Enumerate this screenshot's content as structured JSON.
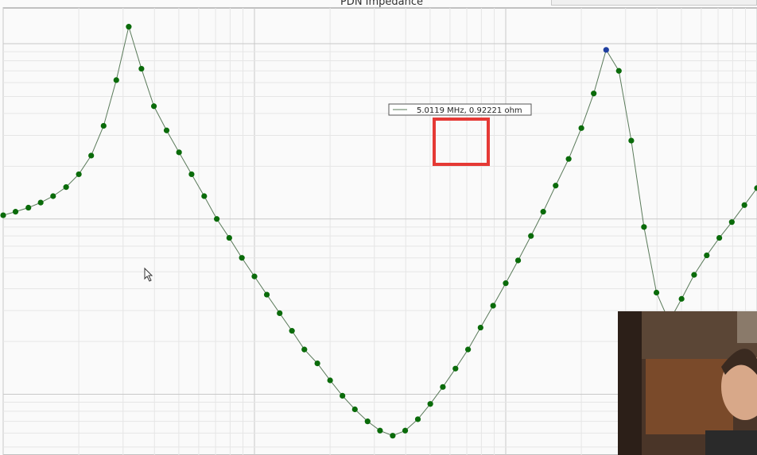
{
  "chart_data": {
    "type": "line",
    "title": "PDN Impedance",
    "xscale": "log",
    "yscale": "log",
    "grid": true,
    "series": [
      {
        "x": [
          0.1,
          0.112,
          0.126,
          0.141,
          0.158,
          0.178,
          0.2,
          0.224,
          0.251,
          0.282,
          0.316,
          0.355,
          0.398,
          0.447,
          0.501,
          0.562,
          0.631,
          0.708,
          0.794,
          0.891,
          1.0,
          1.12,
          1.26,
          1.41,
          1.58,
          1.78,
          2.0,
          2.24,
          2.51,
          2.82,
          3.16,
          3.55,
          3.98,
          4.47,
          5.01,
          5.62,
          6.31,
          7.08,
          7.94,
          8.91,
          10.0,
          11.2,
          12.6,
          14.1,
          15.8,
          17.8,
          20.0,
          22.4,
          25.1,
          28.2,
          31.6,
          35.5,
          39.8,
          44.7,
          50.1,
          56.2,
          63.1,
          70.8,
          79.4,
          89.1,
          100
        ],
        "y": [
          0.105,
          0.11,
          0.116,
          0.124,
          0.135,
          0.152,
          0.18,
          0.23,
          0.34,
          0.62,
          1.25,
          0.72,
          0.44,
          0.32,
          0.24,
          0.18,
          0.135,
          0.1,
          0.078,
          0.06,
          0.047,
          0.037,
          0.029,
          0.023,
          0.018,
          0.015,
          0.012,
          0.0098,
          0.0082,
          0.007,
          0.0062,
          0.0058,
          0.0062,
          0.0072,
          0.0088,
          0.011,
          0.014,
          0.018,
          0.024,
          0.032,
          0.043,
          0.058,
          0.08,
          0.11,
          0.155,
          0.22,
          0.33,
          0.52,
          0.92221,
          0.7,
          0.28,
          0.09,
          0.038,
          0.026,
          0.035,
          0.048,
          0.062,
          0.078,
          0.096,
          0.12,
          0.15
        ]
      }
    ],
    "tooltip": {
      "label": "5.0119 MHz, 0.92221 ohm"
    },
    "line_color": "#5a7a5a",
    "marker_color": "#0a6b0a",
    "highlight_color": "#1f3fa0",
    "box_color": "#e53935"
  }
}
